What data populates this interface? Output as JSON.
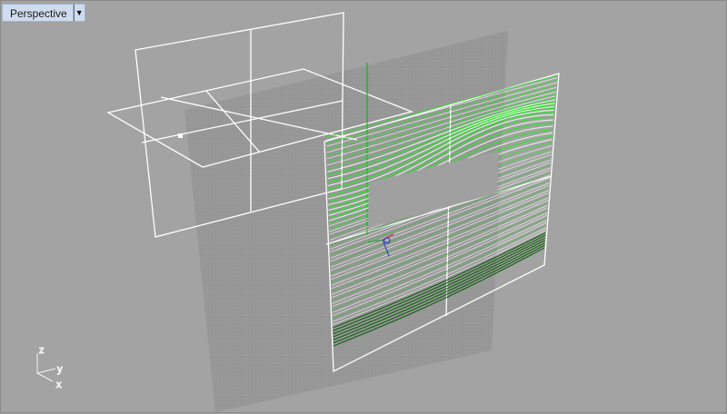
{
  "viewport": {
    "name": "Perspective",
    "menu_icon": "triangle-down-icon"
  },
  "axes": {
    "z": "z",
    "y": "y",
    "x": "x"
  },
  "colors": {
    "background": "#a3a3a3",
    "wireframe": "#ffffff",
    "gridPlane": "#909090",
    "contourBright": "#19f019",
    "contourDark": "#0a5a0a",
    "zAxis": "#14b414"
  }
}
